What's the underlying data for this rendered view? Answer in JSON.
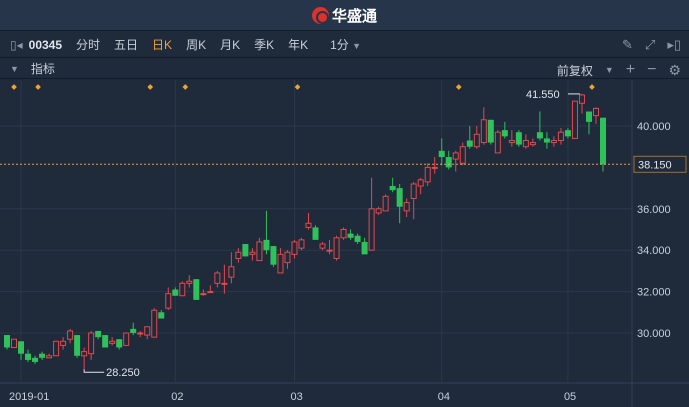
{
  "header": {
    "app_name": "华盛通"
  },
  "toolbar": {
    "symbol": "00345",
    "tabs": [
      "分时",
      "五日",
      "日K",
      "周K",
      "月K",
      "季K",
      "年K"
    ],
    "active_tab": "日K",
    "interval": "1分"
  },
  "indicator_bar": {
    "label": "指标",
    "adjust": "前复权"
  },
  "colors": {
    "up": "#e5484d",
    "down": "#2fc25b",
    "accent": "#f0a431"
  },
  "chart_data": {
    "type": "candlestick",
    "y_ticks": [
      30,
      32,
      34,
      36,
      40
    ],
    "y_tick_labels": [
      "30.000",
      "32.000",
      "34.000",
      "36.000",
      "40.000"
    ],
    "ylim": [
      27.8,
      42.8
    ],
    "x_tick_labels": [
      {
        "label": "2019-01",
        "index": 1
      },
      {
        "label": "02",
        "index": 24
      },
      {
        "label": "03",
        "index": 41
      },
      {
        "label": "04",
        "index": 62
      },
      {
        "label": "05",
        "index": 80
      }
    ],
    "last_price": "38.150",
    "last_value": 38.15,
    "max_label": "41.550",
    "max_index": 82,
    "max_value": 41.55,
    "min_label": "28.250",
    "min_index": 11,
    "min_value": 28.25,
    "marker_indices": [
      1,
      4,
      20,
      25,
      41,
      64,
      83
    ],
    "ohlc": [
      [
        29.9,
        29.9,
        29.2,
        29.3
      ],
      [
        29.3,
        29.7,
        29.3,
        29.7
      ],
      [
        29.6,
        29.6,
        28.7,
        29.0
      ],
      [
        29.0,
        29.2,
        28.6,
        28.7
      ],
      [
        28.8,
        28.9,
        28.5,
        28.6
      ],
      [
        29.0,
        29.1,
        28.7,
        28.8
      ],
      [
        28.8,
        29.0,
        28.8,
        28.9
      ],
      [
        28.9,
        29.6,
        28.9,
        29.6
      ],
      [
        29.4,
        29.8,
        29.2,
        29.6
      ],
      [
        29.7,
        30.2,
        29.5,
        30.1
      ],
      [
        29.9,
        29.9,
        28.8,
        28.9
      ],
      [
        28.9,
        29.3,
        28.25,
        29.1
      ],
      [
        29.0,
        30.1,
        28.7,
        30.0
      ],
      [
        30.1,
        30.1,
        29.7,
        29.8
      ],
      [
        29.9,
        29.9,
        29.3,
        29.3
      ],
      [
        29.5,
        29.8,
        29.4,
        29.6
      ],
      [
        29.7,
        29.7,
        29.2,
        29.3
      ],
      [
        29.4,
        30.0,
        29.4,
        30.0
      ],
      [
        30.2,
        30.5,
        29.9,
        30.0
      ],
      [
        30.0,
        30.1,
        29.8,
        30.0
      ],
      [
        29.9,
        30.3,
        29.7,
        30.3
      ],
      [
        29.8,
        31.2,
        29.8,
        31.1
      ],
      [
        31.0,
        31.1,
        30.7,
        30.7
      ],
      [
        31.2,
        32.2,
        31.1,
        31.9
      ],
      [
        32.1,
        32.2,
        31.8,
        31.8
      ],
      [
        31.8,
        32.5,
        31.8,
        32.4
      ],
      [
        32.4,
        32.8,
        32.2,
        32.5
      ],
      [
        32.6,
        32.6,
        31.6,
        31.6
      ],
      [
        31.9,
        32.1,
        31.8,
        31.9
      ],
      [
        32.0,
        32.3,
        32.0,
        32.0
      ],
      [
        32.4,
        33.0,
        32.2,
        32.9
      ],
      [
        32.4,
        33.3,
        31.9,
        32.4
      ],
      [
        32.7,
        33.9,
        32.4,
        33.2
      ],
      [
        33.6,
        34.1,
        33.4,
        33.9
      ],
      [
        34.3,
        34.3,
        33.7,
        33.7
      ],
      [
        33.8,
        34.1,
        33.5,
        33.9
      ],
      [
        33.5,
        34.6,
        33.5,
        34.4
      ],
      [
        34.5,
        35.9,
        33.8,
        34.0
      ],
      [
        34.2,
        34.2,
        33.2,
        33.3
      ],
      [
        32.9,
        34.1,
        32.9,
        33.8
      ],
      [
        33.4,
        34.0,
        33.1,
        33.9
      ],
      [
        33.8,
        34.5,
        33.6,
        34.4
      ],
      [
        34.1,
        34.6,
        34.0,
        34.5
      ],
      [
        35.1,
        35.8,
        35.0,
        35.3
      ],
      [
        35.1,
        35.2,
        34.5,
        34.5
      ],
      [
        34.1,
        34.4,
        34.0,
        34.3
      ],
      [
        34.0,
        34.5,
        33.8,
        34.0
      ],
      [
        33.6,
        34.7,
        33.5,
        34.6
      ],
      [
        34.6,
        35.1,
        34.5,
        35.0
      ],
      [
        34.8,
        35.0,
        34.5,
        34.6
      ],
      [
        34.7,
        34.8,
        34.3,
        34.4
      ],
      [
        34.4,
        34.6,
        33.8,
        33.8
      ],
      [
        34.0,
        37.5,
        34.0,
        36.0
      ],
      [
        35.8,
        36.1,
        35.7,
        36.0
      ],
      [
        35.9,
        36.7,
        35.9,
        36.6
      ],
      [
        37.1,
        37.5,
        36.8,
        36.9
      ],
      [
        37.0,
        37.2,
        35.3,
        36.1
      ],
      [
        35.9,
        36.5,
        35.6,
        36.3
      ],
      [
        36.5,
        37.3,
        35.5,
        37.2
      ],
      [
        37.1,
        37.5,
        36.7,
        37.4
      ],
      [
        37.3,
        38.2,
        37.1,
        38.0
      ],
      [
        38.0,
        38.5,
        37.7,
        38.0
      ],
      [
        38.8,
        39.4,
        38.1,
        38.5
      ],
      [
        38.5,
        38.8,
        37.9,
        38.0
      ],
      [
        38.4,
        38.8,
        37.8,
        38.7
      ],
      [
        38.2,
        39.2,
        38.1,
        39.0
      ],
      [
        39.3,
        40.0,
        38.9,
        39.0
      ],
      [
        39.0,
        40.0,
        38.9,
        39.6
      ],
      [
        39.2,
        40.9,
        39.1,
        40.3
      ],
      [
        40.3,
        40.3,
        39.1,
        39.2
      ],
      [
        38.7,
        39.8,
        38.7,
        39.7
      ],
      [
        39.8,
        40.2,
        39.4,
        39.5
      ],
      [
        39.2,
        39.8,
        39.0,
        39.3
      ],
      [
        39.7,
        39.8,
        39.0,
        39.1
      ],
      [
        39.0,
        39.6,
        38.9,
        39.3
      ],
      [
        39.1,
        39.4,
        39.0,
        39.2
      ],
      [
        39.7,
        40.7,
        39.3,
        39.4
      ],
      [
        39.4,
        39.7,
        38.9,
        39.2
      ],
      [
        39.2,
        39.5,
        39.0,
        39.3
      ],
      [
        39.3,
        39.9,
        39.1,
        39.7
      ],
      [
        39.8,
        39.9,
        39.4,
        39.5
      ],
      [
        39.4,
        41.2,
        39.4,
        41.2
      ],
      [
        41.1,
        41.55,
        40.6,
        41.5
      ],
      [
        40.7,
        40.7,
        39.6,
        40.2
      ],
      [
        40.5,
        40.9,
        40.1,
        40.85
      ],
      [
        40.4,
        40.4,
        37.8,
        38.15
      ]
    ]
  }
}
